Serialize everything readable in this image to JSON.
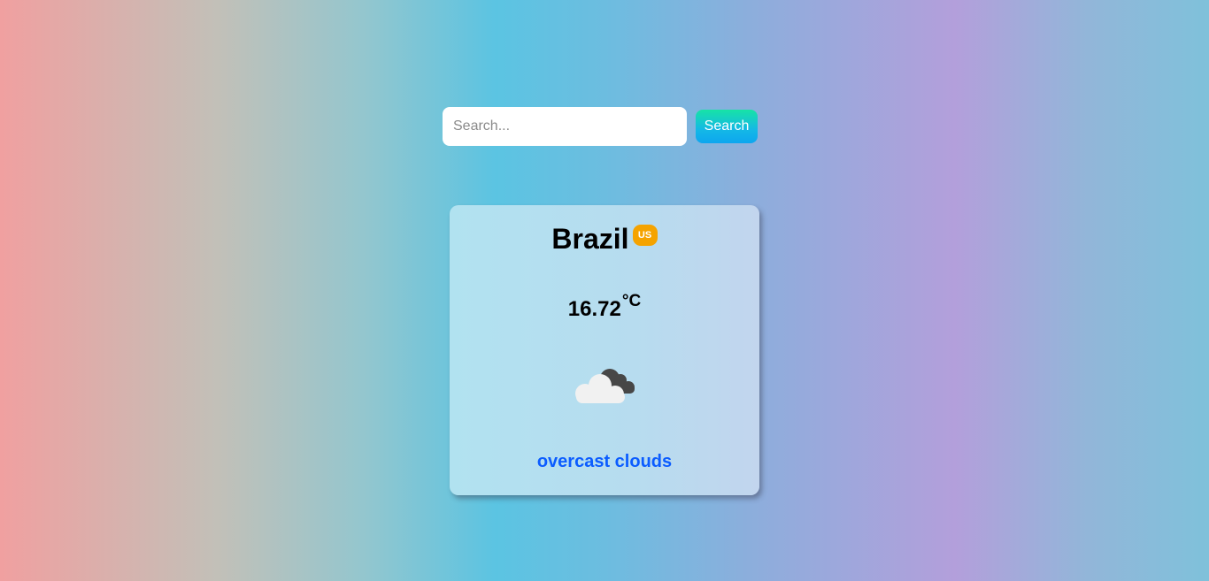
{
  "search": {
    "placeholder": "Search...",
    "value": "",
    "button_label": "Search"
  },
  "weather": {
    "city": "Brazil",
    "country_code": "US",
    "temperature": "16.72",
    "unit": "°C",
    "description": "overcast clouds",
    "icon": "overcast-clouds-icon"
  },
  "colors": {
    "description_text": "#0b5cff",
    "badge": "#f5a300",
    "button_gradient_start": "#17e3a6",
    "button_gradient_end": "#0da6ef"
  }
}
